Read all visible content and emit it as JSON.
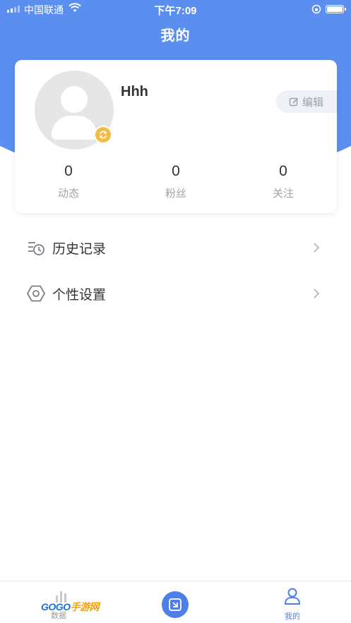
{
  "status_bar": {
    "carrier": "中国联通",
    "time": "下午7:09"
  },
  "nav": {
    "title": "我的"
  },
  "profile": {
    "username": "Hhh",
    "edit_label": "编辑",
    "stats": [
      {
        "value": "0",
        "label": "动态"
      },
      {
        "value": "0",
        "label": "粉丝"
      },
      {
        "value": "0",
        "label": "关注"
      }
    ]
  },
  "menu": [
    {
      "label": "历史记录",
      "icon": "history-icon"
    },
    {
      "label": "个性设置",
      "icon": "settings-hexagon-icon"
    }
  ],
  "tabbar": {
    "left_label": "数据",
    "right_label": "我的",
    "watermark": "GOGO手游网"
  },
  "colors": {
    "header_blue": "#5a8ff0",
    "accent": "#4e7fe8",
    "badge": "#f4bb45"
  }
}
